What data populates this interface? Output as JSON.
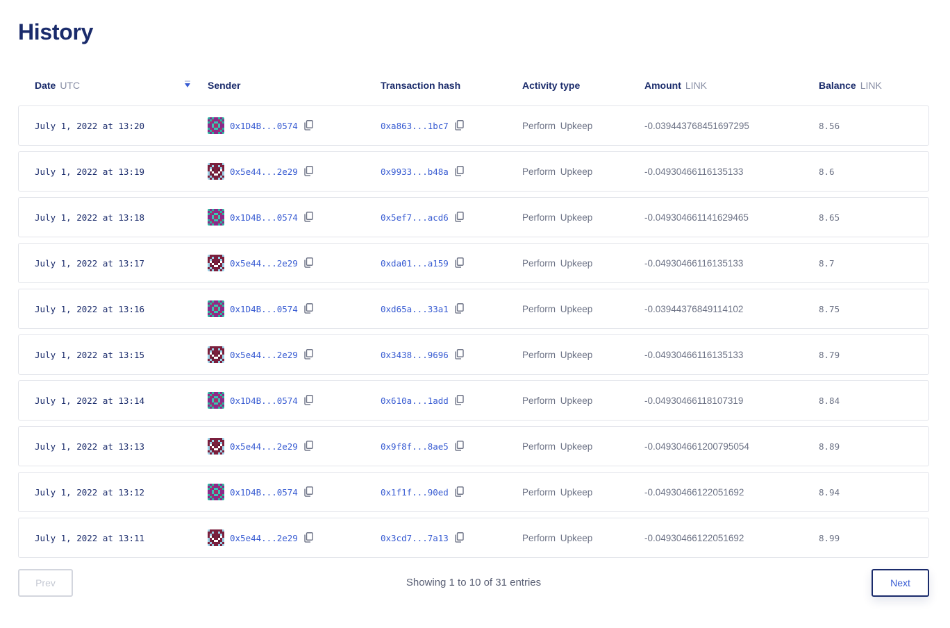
{
  "page": {
    "title": "History"
  },
  "table": {
    "headers": {
      "date": "Date",
      "date_unit": "UTC",
      "sender": "Sender",
      "hash": "Transaction hash",
      "type": "Activity type",
      "amount": "Amount",
      "amount_unit": "LINK",
      "balance": "Balance",
      "balance_unit": "LINK"
    },
    "rows": [
      {
        "date": "July 1, 2022 at 13:20",
        "sender": "0x1D4B...0574",
        "avatar": "a",
        "hash": "0xa863...1bc7",
        "type": "Perform Upkeep",
        "amount": "-0.039443768451697295",
        "balance": "8.56"
      },
      {
        "date": "July 1, 2022 at 13:19",
        "sender": "0x5e44...2e29",
        "avatar": "b",
        "hash": "0x9933...b48a",
        "type": "Perform Upkeep",
        "amount": "-0.04930466116135133",
        "balance": "8.6"
      },
      {
        "date": "July 1, 2022 at 13:18",
        "sender": "0x1D4B...0574",
        "avatar": "a",
        "hash": "0x5ef7...acd6",
        "type": "Perform Upkeep",
        "amount": "-0.049304661141629465",
        "balance": "8.65"
      },
      {
        "date": "July 1, 2022 at 13:17",
        "sender": "0x5e44...2e29",
        "avatar": "b",
        "hash": "0xda01...a159",
        "type": "Perform Upkeep",
        "amount": "-0.04930466116135133",
        "balance": "8.7"
      },
      {
        "date": "July 1, 2022 at 13:16",
        "sender": "0x1D4B...0574",
        "avatar": "a",
        "hash": "0xd65a...33a1",
        "type": "Perform Upkeep",
        "amount": "-0.03944376849114102",
        "balance": "8.75"
      },
      {
        "date": "July 1, 2022 at 13:15",
        "sender": "0x5e44...2e29",
        "avatar": "b",
        "hash": "0x3438...9696",
        "type": "Perform Upkeep",
        "amount": "-0.04930466116135133",
        "balance": "8.79"
      },
      {
        "date": "July 1, 2022 at 13:14",
        "sender": "0x1D4B...0574",
        "avatar": "a",
        "hash": "0x610a...1add",
        "type": "Perform Upkeep",
        "amount": "-0.04930466118107319",
        "balance": "8.84"
      },
      {
        "date": "July 1, 2022 at 13:13",
        "sender": "0x5e44...2e29",
        "avatar": "b",
        "hash": "0x9f8f...8ae5",
        "type": "Perform Upkeep",
        "amount": "-0.049304661200795054",
        "balance": "8.89"
      },
      {
        "date": "July 1, 2022 at 13:12",
        "sender": "0x1D4B...0574",
        "avatar": "a",
        "hash": "0x1f1f...90ed",
        "type": "Perform Upkeep",
        "amount": "-0.04930466122051692",
        "balance": "8.94"
      },
      {
        "date": "July 1, 2022 at 13:11",
        "sender": "0x5e44...2e29",
        "avatar": "b",
        "hash": "0x3cd7...7a13",
        "type": "Perform Upkeep",
        "amount": "-0.04930466122051692",
        "balance": "8.99"
      }
    ]
  },
  "pagination": {
    "prev_label": "Prev",
    "next_label": "Next",
    "showing_text": "Showing 1 to 10 of 31 entries"
  },
  "icons": {
    "sort": "sort-desc-icon",
    "copy": "copy-icon",
    "avatar": "identicon-avatar-icon"
  },
  "colors": {
    "navy": "#1a2b6b",
    "link_blue": "#375bd2",
    "muted": "#6c7285",
    "border": "#e2e4ea",
    "avatar_a": [
      "#2bb3a0",
      "#8a2a8a",
      "#a03070",
      "#3ac7b0"
    ],
    "avatar_b": [
      "#7a1f3d",
      "#9ad0e6",
      "#ffffff",
      "#5c1830"
    ]
  }
}
